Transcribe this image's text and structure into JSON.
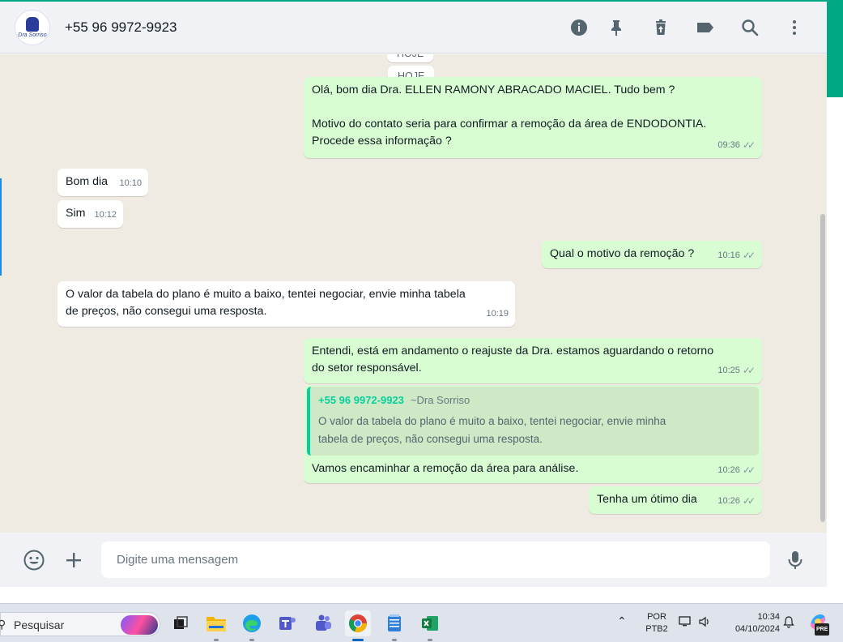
{
  "header": {
    "contact_name": "+55 96 9972-9923",
    "avatar_brand": "Dra Sorriso",
    "icons": [
      "info-icon",
      "pin-icon",
      "delete-icon",
      "label-icon",
      "search-icon",
      "more-icon"
    ]
  },
  "chat": {
    "date_pill_top": "HOJE",
    "date_pill": "HOJE",
    "messages": [
      {
        "direction": "out",
        "lines": [
          "Olá, bom dia Dra. ELLEN RAMONY ABRACADO MACIEL. Tudo bem ?",
          "",
          "Motivo do contato seria para confirmar a remoção da área de ENDODONTIA.",
          "Procede essa informação ?"
        ],
        "time": "09:36"
      },
      {
        "direction": "in",
        "text": "Bom dia",
        "time": "10:10"
      },
      {
        "direction": "in",
        "text": "Sim",
        "time": "10:12"
      },
      {
        "direction": "out",
        "text": "Qual o motivo da remoção ?",
        "time": "10:16"
      },
      {
        "direction": "in",
        "lines": [
          "O valor da tabela do plano é muito a baixo, tentei negociar, envie minha tabela",
          "de preços, não consegui uma resposta."
        ],
        "time": "10:19"
      },
      {
        "direction": "out",
        "lines": [
          "Entendi, está em andamento o reajuste da Dra. estamos aguardando o retorno",
          "do setor responsável."
        ],
        "time": "10:25"
      },
      {
        "direction": "out",
        "quote": {
          "name": "+55 96 9972-9923",
          "alias": "~Dra Sorriso",
          "lines": [
            "O valor da tabela do plano é muito a baixo, tentei negociar, envie minha",
            "tabela de preços, não consegui uma resposta."
          ]
        },
        "text": "Vamos encaminhar a remoção da área para análise.",
        "time": "10:26"
      },
      {
        "direction": "out",
        "text": "Tenha um ótimo dia",
        "time": "10:26"
      }
    ]
  },
  "footer": {
    "placeholder": "Digite uma mensagem",
    "icons": [
      "emoji-icon",
      "attach-plus-icon",
      "microphone-icon"
    ]
  },
  "taskbar": {
    "search_label": "Pesquisar",
    "apps": [
      "task-view",
      "file-explorer",
      "edge",
      "teams-classic",
      "teams",
      "chrome",
      "notepad",
      "excel"
    ],
    "language": "POR",
    "keyboard": "PTB2",
    "time": "10:34",
    "date": "04/10/2024",
    "copilot_badge": "PRE"
  },
  "colors": {
    "accent": "#00a884",
    "outgoing_bubble": "#d9fdd3",
    "incoming_bubble": "#ffffff",
    "chat_background": "#efeae2",
    "quote_name": "#06cf9c"
  }
}
